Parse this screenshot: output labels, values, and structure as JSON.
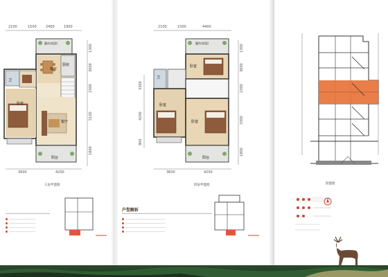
{
  "left_page": {
    "top_dims": [
      "2100",
      "1500",
      "2400",
      "1900"
    ],
    "bottom_dims": [
      "3600",
      "4200"
    ],
    "right_dims": [
      "1300",
      "3000",
      "2300",
      "5100",
      "1800"
    ],
    "rooms": {
      "terrace_top": "露台(花园)",
      "dining": "餐厅",
      "kitchen": "厨房",
      "bath": "卫",
      "bedroom": "卧室",
      "living": "客厅",
      "terrace_bottom": "阳台"
    },
    "plan_caption": "三层平面图"
  },
  "middle_page": {
    "top_dims": [
      "2100",
      "1500",
      "4400"
    ],
    "bottom_dims": [
      "3600",
      "4200"
    ],
    "right_dims": [
      "1300",
      "3600",
      "2300",
      "3300",
      "1800"
    ],
    "left_dims": [
      "3300",
      "4200",
      "900"
    ],
    "rooms": {
      "terrace_top": "露台(花园)",
      "bedroom_top": "卧室",
      "bath": "卫",
      "bedroom_left": "卧室",
      "bedroom_right": "卧室",
      "terrace_bottom": "阳台"
    },
    "plan_caption": "四层平面图",
    "analysis_title": "户型解析"
  },
  "right_page": {
    "section_caption": "剖面图"
  },
  "colors": {
    "accent": "#e8733a",
    "brand_red": "#c6483a",
    "footer_green": "#2a4a2a"
  }
}
